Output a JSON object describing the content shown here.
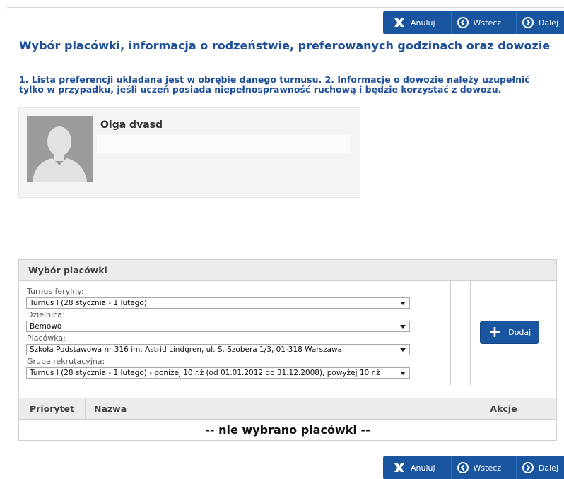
{
  "nav": {
    "cancel_label": "Anuluj",
    "back_label": "Wstecz",
    "next_label": "Dalej"
  },
  "page": {
    "title": "Wybór placówki, informacja o rodzeństwie, preferowanych godzinach oraz dowozie",
    "info_line1": "1. Lista preferencji układana jest w obrębie danego turnusu. 2. Informacje o dowozie należy uzupełnić",
    "info_line2": "tylko w przypadku, jeśli uczeń posiada niepełnosprawność ruchową i będzie korzystać z dowozu."
  },
  "person": {
    "name": "Olga dvasd",
    "avatar_icon": "user-silhouette-icon"
  },
  "panel": {
    "title": "Wybór placówki",
    "fields": [
      {
        "label": "Turnus feryjny:",
        "value": "Turnus I (28 stycznia - 1 lutego)"
      },
      {
        "label": "Dzielnica:",
        "value": "Bemowo"
      },
      {
        "label": "Placówka:",
        "value": "Szkoła Podstawowa nr 316 im. Astrid Lindgren, ul. S. Szobera 1/3, 01-318 Warszawa"
      },
      {
        "label": "Grupa rekrutacyjna:",
        "value": "Turnus I (28 stycznia - 1 lutego) - poniżej 10 r.ż (od 01.01.2012 do 31.12.2008), powyżej 10 r.ż"
      }
    ],
    "add_label": "Dodaj"
  },
  "table": {
    "col_priority": "Priorytet",
    "col_name": "Nazwa",
    "col_actions": "Akcje",
    "empty_text": "-- nie wybrano placówki --"
  },
  "colors": {
    "primary": "#1a56a0",
    "heading": "#1e4f98",
    "panel_header": "#ececec"
  }
}
